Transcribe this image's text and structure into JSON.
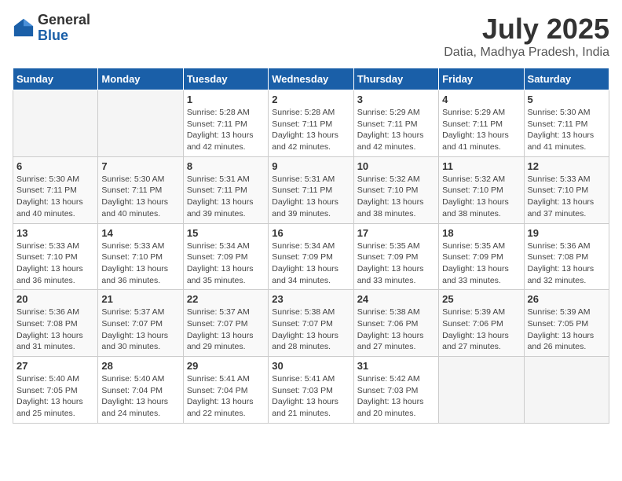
{
  "header": {
    "logo_general": "General",
    "logo_blue": "Blue",
    "month": "July 2025",
    "location": "Datia, Madhya Pradesh, India"
  },
  "weekdays": [
    "Sunday",
    "Monday",
    "Tuesday",
    "Wednesday",
    "Thursday",
    "Friday",
    "Saturday"
  ],
  "weeks": [
    [
      {
        "day": "",
        "info": ""
      },
      {
        "day": "",
        "info": ""
      },
      {
        "day": "1",
        "info": "Sunrise: 5:28 AM\nSunset: 7:11 PM\nDaylight: 13 hours and 42 minutes."
      },
      {
        "day": "2",
        "info": "Sunrise: 5:28 AM\nSunset: 7:11 PM\nDaylight: 13 hours and 42 minutes."
      },
      {
        "day": "3",
        "info": "Sunrise: 5:29 AM\nSunset: 7:11 PM\nDaylight: 13 hours and 42 minutes."
      },
      {
        "day": "4",
        "info": "Sunrise: 5:29 AM\nSunset: 7:11 PM\nDaylight: 13 hours and 41 minutes."
      },
      {
        "day": "5",
        "info": "Sunrise: 5:30 AM\nSunset: 7:11 PM\nDaylight: 13 hours and 41 minutes."
      }
    ],
    [
      {
        "day": "6",
        "info": "Sunrise: 5:30 AM\nSunset: 7:11 PM\nDaylight: 13 hours and 40 minutes."
      },
      {
        "day": "7",
        "info": "Sunrise: 5:30 AM\nSunset: 7:11 PM\nDaylight: 13 hours and 40 minutes."
      },
      {
        "day": "8",
        "info": "Sunrise: 5:31 AM\nSunset: 7:11 PM\nDaylight: 13 hours and 39 minutes."
      },
      {
        "day": "9",
        "info": "Sunrise: 5:31 AM\nSunset: 7:11 PM\nDaylight: 13 hours and 39 minutes."
      },
      {
        "day": "10",
        "info": "Sunrise: 5:32 AM\nSunset: 7:10 PM\nDaylight: 13 hours and 38 minutes."
      },
      {
        "day": "11",
        "info": "Sunrise: 5:32 AM\nSunset: 7:10 PM\nDaylight: 13 hours and 38 minutes."
      },
      {
        "day": "12",
        "info": "Sunrise: 5:33 AM\nSunset: 7:10 PM\nDaylight: 13 hours and 37 minutes."
      }
    ],
    [
      {
        "day": "13",
        "info": "Sunrise: 5:33 AM\nSunset: 7:10 PM\nDaylight: 13 hours and 36 minutes."
      },
      {
        "day": "14",
        "info": "Sunrise: 5:33 AM\nSunset: 7:10 PM\nDaylight: 13 hours and 36 minutes."
      },
      {
        "day": "15",
        "info": "Sunrise: 5:34 AM\nSunset: 7:09 PM\nDaylight: 13 hours and 35 minutes."
      },
      {
        "day": "16",
        "info": "Sunrise: 5:34 AM\nSunset: 7:09 PM\nDaylight: 13 hours and 34 minutes."
      },
      {
        "day": "17",
        "info": "Sunrise: 5:35 AM\nSunset: 7:09 PM\nDaylight: 13 hours and 33 minutes."
      },
      {
        "day": "18",
        "info": "Sunrise: 5:35 AM\nSunset: 7:09 PM\nDaylight: 13 hours and 33 minutes."
      },
      {
        "day": "19",
        "info": "Sunrise: 5:36 AM\nSunset: 7:08 PM\nDaylight: 13 hours and 32 minutes."
      }
    ],
    [
      {
        "day": "20",
        "info": "Sunrise: 5:36 AM\nSunset: 7:08 PM\nDaylight: 13 hours and 31 minutes."
      },
      {
        "day": "21",
        "info": "Sunrise: 5:37 AM\nSunset: 7:07 PM\nDaylight: 13 hours and 30 minutes."
      },
      {
        "day": "22",
        "info": "Sunrise: 5:37 AM\nSunset: 7:07 PM\nDaylight: 13 hours and 29 minutes."
      },
      {
        "day": "23",
        "info": "Sunrise: 5:38 AM\nSunset: 7:07 PM\nDaylight: 13 hours and 28 minutes."
      },
      {
        "day": "24",
        "info": "Sunrise: 5:38 AM\nSunset: 7:06 PM\nDaylight: 13 hours and 27 minutes."
      },
      {
        "day": "25",
        "info": "Sunrise: 5:39 AM\nSunset: 7:06 PM\nDaylight: 13 hours and 27 minutes."
      },
      {
        "day": "26",
        "info": "Sunrise: 5:39 AM\nSunset: 7:05 PM\nDaylight: 13 hours and 26 minutes."
      }
    ],
    [
      {
        "day": "27",
        "info": "Sunrise: 5:40 AM\nSunset: 7:05 PM\nDaylight: 13 hours and 25 minutes."
      },
      {
        "day": "28",
        "info": "Sunrise: 5:40 AM\nSunset: 7:04 PM\nDaylight: 13 hours and 24 minutes."
      },
      {
        "day": "29",
        "info": "Sunrise: 5:41 AM\nSunset: 7:04 PM\nDaylight: 13 hours and 22 minutes."
      },
      {
        "day": "30",
        "info": "Sunrise: 5:41 AM\nSunset: 7:03 PM\nDaylight: 13 hours and 21 minutes."
      },
      {
        "day": "31",
        "info": "Sunrise: 5:42 AM\nSunset: 7:03 PM\nDaylight: 13 hours and 20 minutes."
      },
      {
        "day": "",
        "info": ""
      },
      {
        "day": "",
        "info": ""
      }
    ]
  ]
}
